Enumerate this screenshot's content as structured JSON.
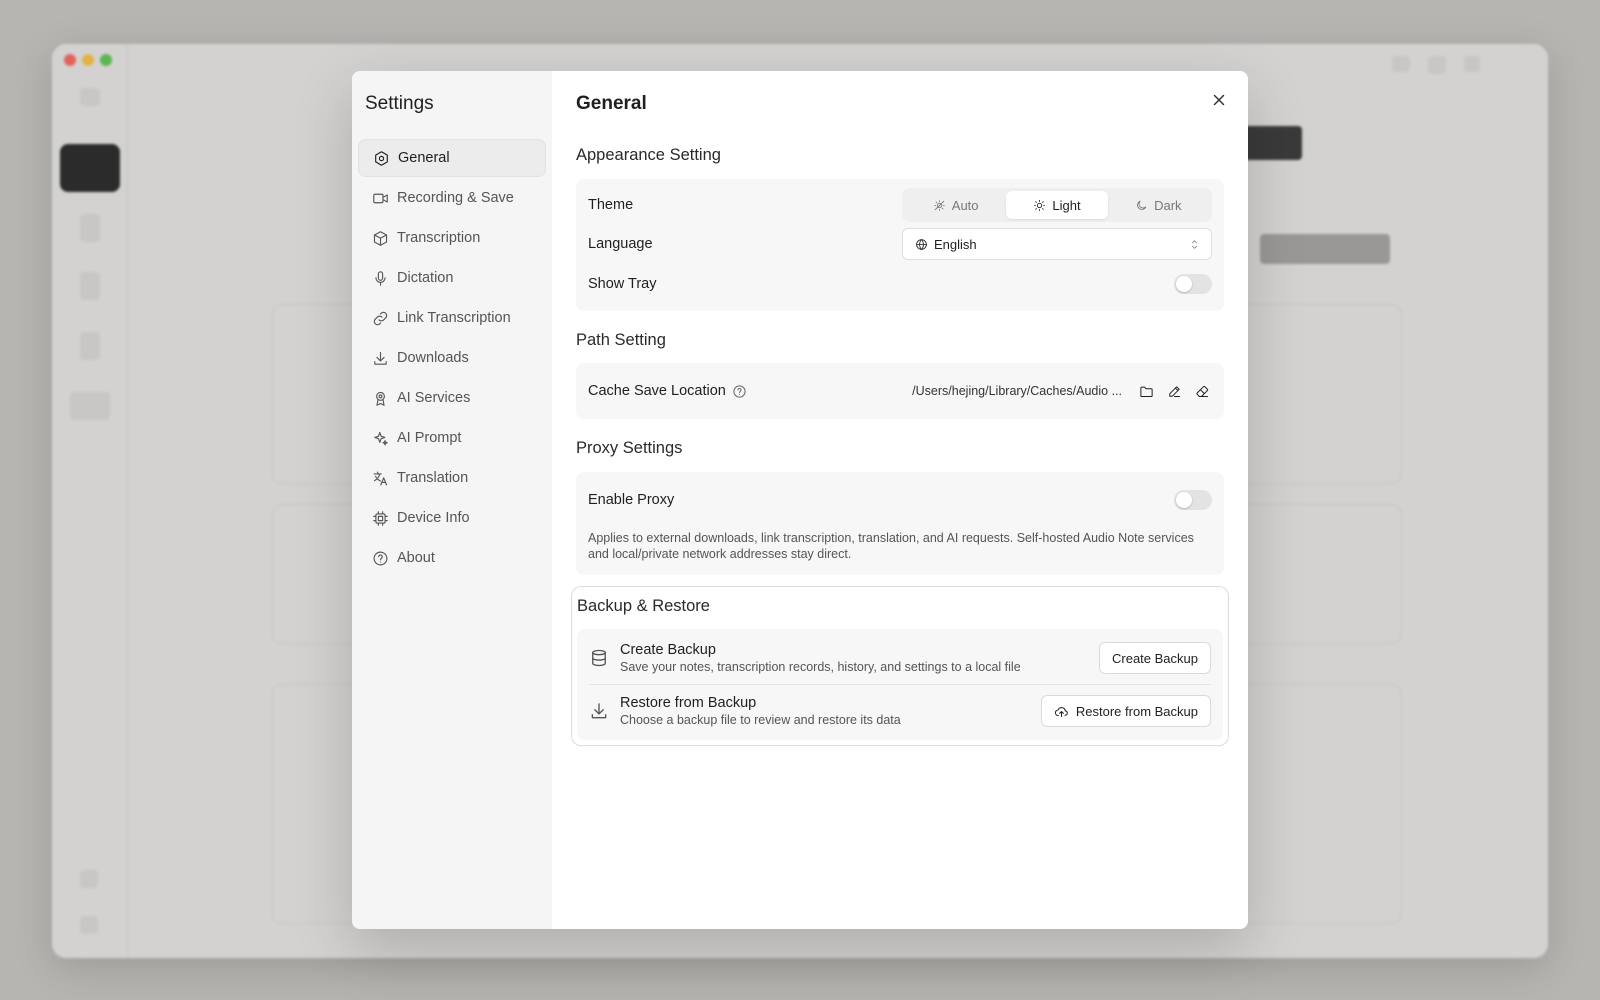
{
  "settings": {
    "sidebar_title": "Settings",
    "nav": [
      {
        "label": "General",
        "icon": "hexagon-gear-icon"
      },
      {
        "label": "Recording & Save",
        "icon": "video-camera-icon"
      },
      {
        "label": "Transcription",
        "icon": "cube-icon"
      },
      {
        "label": "Dictation",
        "icon": "microphone-icon"
      },
      {
        "label": "Link Transcription",
        "icon": "link-icon"
      },
      {
        "label": "Downloads",
        "icon": "download-icon"
      },
      {
        "label": "AI Services",
        "icon": "ribbon-icon"
      },
      {
        "label": "AI Prompt",
        "icon": "sparkles-icon"
      },
      {
        "label": "Translation",
        "icon": "translate-icon"
      },
      {
        "label": "Device Info",
        "icon": "chip-icon"
      },
      {
        "label": "About",
        "icon": "help-circle-icon"
      }
    ],
    "active_nav": "General"
  },
  "general": {
    "title": "General",
    "appearance": {
      "section_title": "Appearance Setting",
      "theme_label": "Theme",
      "theme_options": [
        "Auto",
        "Light",
        "Dark"
      ],
      "theme_selected": "Light",
      "language_label": "Language",
      "language_value": "English",
      "show_tray_label": "Show Tray",
      "show_tray_on": false
    },
    "path": {
      "section_title": "Path Setting",
      "cache_label": "Cache Save Location",
      "cache_value": "/Users/hejing/Library/Caches/Audio ..."
    },
    "proxy": {
      "section_title": "Proxy Settings",
      "enable_label": "Enable Proxy",
      "enable_on": false,
      "description": "Applies to external downloads, link transcription, translation, and AI requests. Self-hosted Audio Note services and local/private network addresses stay direct."
    },
    "backup": {
      "section_title": "Backup & Restore",
      "create_title": "Create Backup",
      "create_desc": "Save your notes, transcription records, history, and settings to a local file",
      "create_button": "Create Backup",
      "restore_title": "Restore from Backup",
      "restore_desc": "Choose a backup file to review and restore its data",
      "restore_button": "Restore from Backup"
    }
  }
}
